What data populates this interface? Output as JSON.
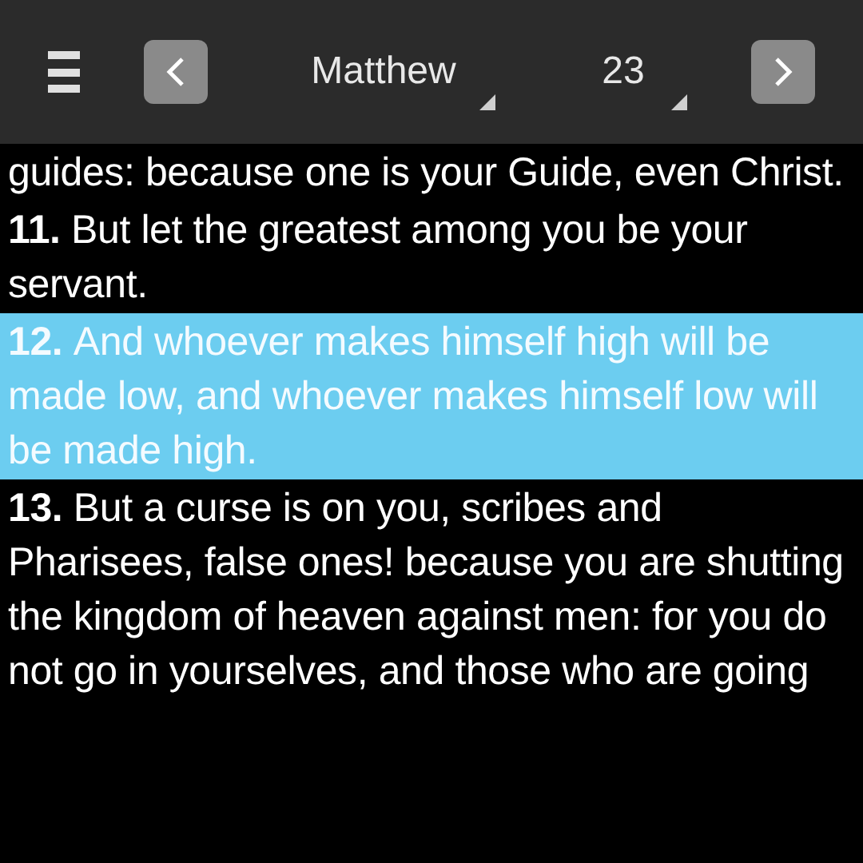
{
  "toolbar": {
    "book": "Matthew",
    "chapter": "23"
  },
  "verses": [
    {
      "text": "guides: because one is your Guide, even Christ.",
      "selected": false
    },
    {
      "number": "11.",
      "text": "But let the greatest among you be your servant.",
      "selected": false
    },
    {
      "number": "12.",
      "text": "And whoever makes himself high will be made low, and whoever makes himself low will be made high.",
      "selected": true
    },
    {
      "number": "13.",
      "text": "But a curse is on you, scribes and Pharisees, false ones! because you are shutting the kingdom of heaven against men: for you do not go in yourselves, and those who are going",
      "selected": false
    }
  ]
}
